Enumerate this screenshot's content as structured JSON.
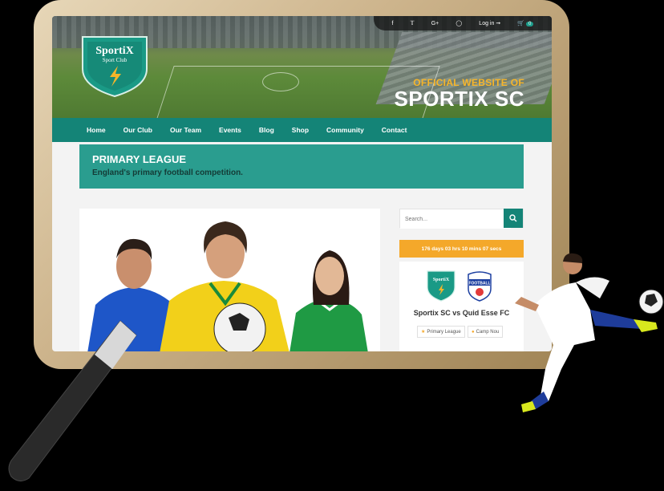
{
  "topbar": {
    "icons": [
      "facebook-icon",
      "twitter-icon",
      "google-plus-icon",
      "instagram-icon"
    ],
    "login_label": "Log in",
    "cart_count": "0"
  },
  "logo": {
    "line1": "SportiX",
    "line2": "Sport Club"
  },
  "hero": {
    "official": "OFFICIAL WEBSITE OF",
    "site_name": "SPORTIX SC"
  },
  "nav": {
    "items": [
      "Home",
      "Our Club",
      "Our Team",
      "Events",
      "Blog",
      "Shop",
      "Community",
      "Contact"
    ]
  },
  "banner": {
    "title": "PRIMARY LEAGUE",
    "subtitle": "England's primary football competition."
  },
  "sidebar": {
    "search_placeholder": "Search...",
    "countdown": "176 days 03 hrs 10 mins 07 secs",
    "match_title": "Sportix SC vs Quid Esse FC",
    "tags": [
      "Primary League",
      "Camp Nou"
    ],
    "away_logo_text": "FOOTBALL"
  },
  "colors": {
    "brand": "#148477",
    "accent": "#f4a82a",
    "banner": "#2a9d8f"
  }
}
